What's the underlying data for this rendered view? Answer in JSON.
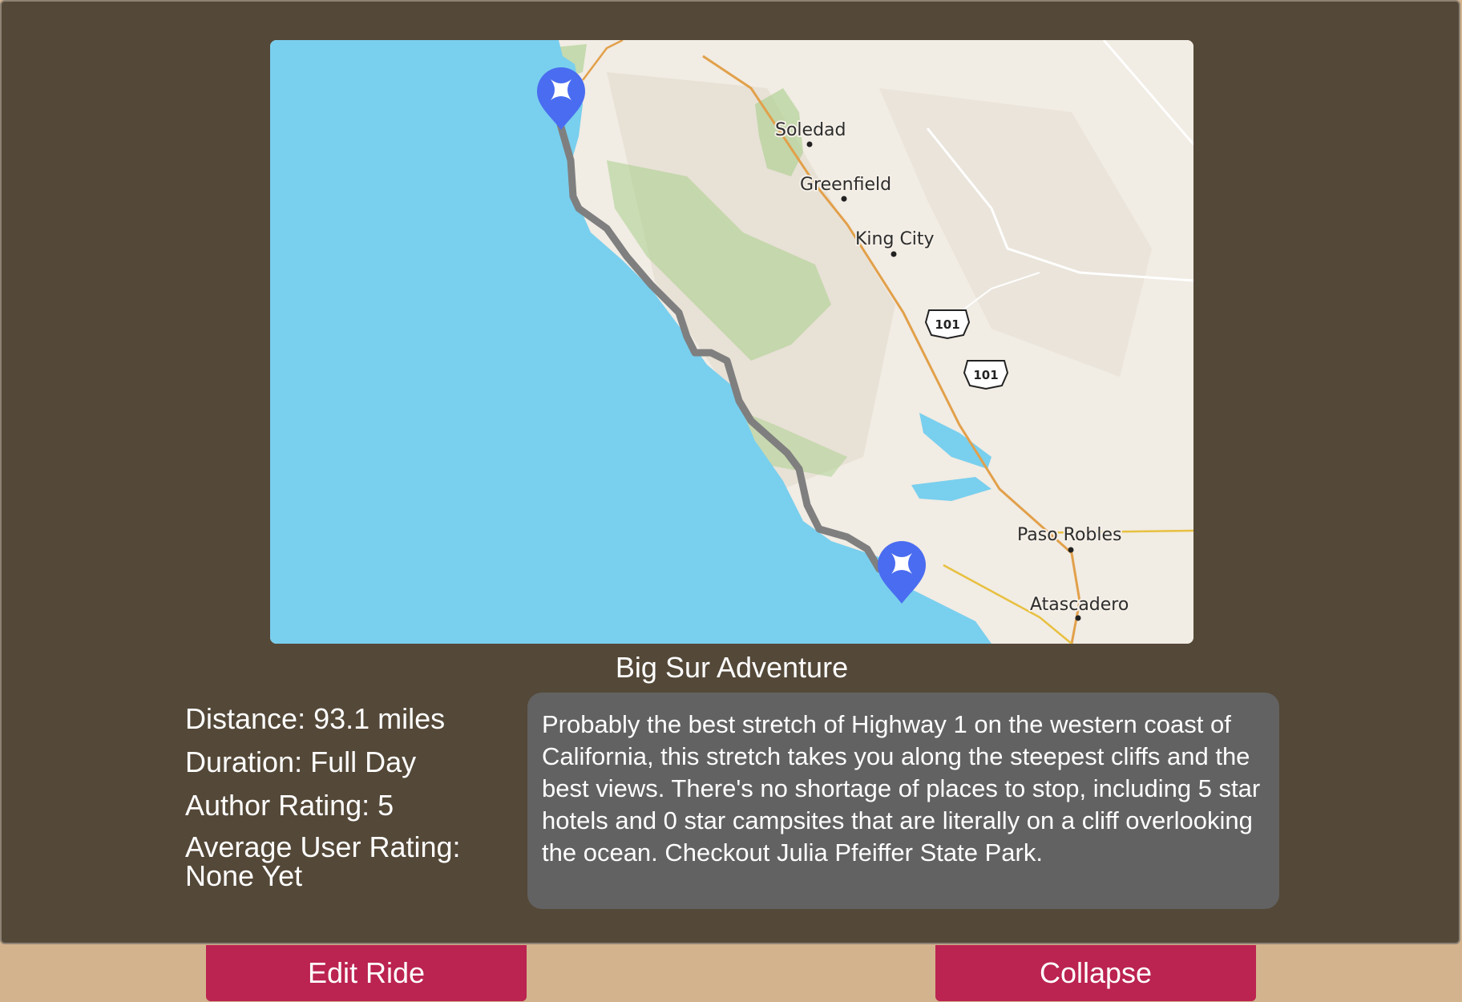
{
  "map": {
    "places": [
      {
        "name": "Soledad"
      },
      {
        "name": "Greenfield"
      },
      {
        "name": "King City"
      },
      {
        "name": "Paso Robles"
      },
      {
        "name": "Atascadero"
      }
    ],
    "highway_shields": [
      "101",
      "101"
    ],
    "markers": [
      {
        "name": "start-marker",
        "icon": "star-pin-icon"
      },
      {
        "name": "end-marker",
        "icon": "star-pin-icon"
      }
    ],
    "colors": {
      "water": "#79cfee",
      "land": "#f1ece4",
      "park": "#a8cf8a",
      "route": "#7f7f7f",
      "marker": "#4a6cf0",
      "highway": "#e2a04a"
    }
  },
  "ride": {
    "title": "Big Sur Adventure",
    "stats": {
      "distance": "Distance: 93.1 miles",
      "duration": "Duration: Full Day",
      "author_rating": "Author Rating: 5",
      "avg_rating_label": "Average User Rating:",
      "avg_rating_value": "None Yet"
    },
    "description": "Probably the best stretch of Highway 1 on the western coast of California, this stretch takes you along the steepest cliffs and the best views. There's no shortage of places to stop, including 5 star hotels and 0 star campsites that are literally on a cliff overlooking the ocean. Checkout Julia Pfeiffer State Park."
  },
  "buttons": {
    "edit": "Edit Ride",
    "collapse": "Collapse"
  },
  "colors": {
    "card": "#544838",
    "page": "#d3b38e",
    "button": "#bb2350",
    "description_box": "#626262"
  }
}
